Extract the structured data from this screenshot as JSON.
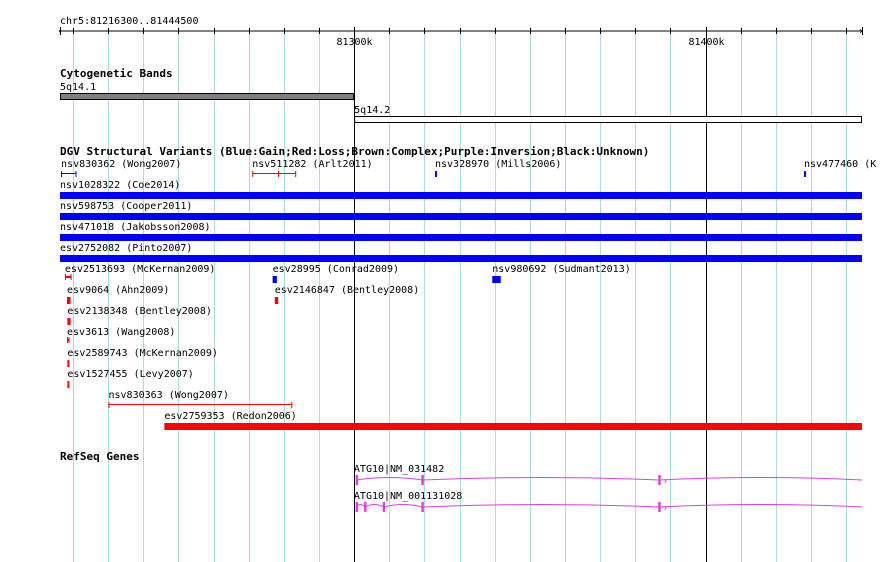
{
  "colors": {
    "gridline": "#add8e6",
    "gain": "#0000ff",
    "loss": "#ff0000",
    "refseq": "#e040e0",
    "cyto_gpos": "#808080",
    "cyto_gneg": "#ffffff"
  },
  "ruler": {
    "label": "chr5:81216300..81444500",
    "region_start": 81216300,
    "region_end": 81444500,
    "major_ticks": [
      {
        "pos": 81300000,
        "label": "81300k"
      },
      {
        "pos": 81400000,
        "label": "81400k"
      }
    ],
    "minor_tick_step": 10000
  },
  "tracks": {
    "cyto": {
      "title": "Cytogenetic Bands",
      "bands": [
        {
          "name": "5q14.1",
          "start": 81216300,
          "end": 81300000,
          "stain": "gpos"
        },
        {
          "name": "5q14.2",
          "start": 81300000,
          "end": 81444500,
          "stain": "gneg"
        }
      ]
    },
    "dgv": {
      "title": "DGV Structural Variants (Blue:Gain;Red:Loss;Brown:Complex;Purple:Inversion;Black:Unknown)",
      "features": [
        {
          "name": "nsv830362 (Wong2007)",
          "type": "gain",
          "start": 81216600,
          "end": 81221000,
          "row": 0,
          "style": "thin"
        },
        {
          "name": "nsv511282 (Arlt2011)",
          "type": "loss",
          "start": 81271000,
          "end": 81283500,
          "row": 0,
          "style": "thin",
          "ticks": [
            81278400
          ]
        },
        {
          "name": "nsv328970 (Mills2006)",
          "type": "gain",
          "start": 81323000,
          "end": 81323600,
          "row": 0,
          "style": "thin"
        },
        {
          "name": "nsv477460 (K",
          "type": "gain",
          "start": 81428000,
          "end": 81428600,
          "row": 0,
          "style": "thin"
        },
        {
          "name": "nsv1028322 (Coe2014)",
          "type": "gain",
          "start": 81216300,
          "end": 81444500,
          "row": 1,
          "style": "thick"
        },
        {
          "name": "nsv598753 (Cooper2011)",
          "type": "gain",
          "start": 81216300,
          "end": 81444500,
          "row": 2,
          "style": "thick"
        },
        {
          "name": "nsv471018 (Jakobsson2008)",
          "type": "gain",
          "start": 81216300,
          "end": 81444500,
          "row": 3,
          "style": "thick"
        },
        {
          "name": "esv2752082 (Pinto2007)",
          "type": "gain",
          "start": 81216300,
          "end": 81444500,
          "row": 4,
          "style": "thick"
        },
        {
          "name": "esv2513693 (McKernan2009)",
          "type": "loss",
          "start": 81217700,
          "end": 81219600,
          "row": 5,
          "style": "tiny"
        },
        {
          "name": "esv28995 (Conrad2009)",
          "type": "gain",
          "start": 81276800,
          "end": 81278000,
          "row": 5,
          "style": "block"
        },
        {
          "name": "nsv980692 (Sudmant2013)",
          "type": "gain",
          "start": 81339300,
          "end": 81341700,
          "row": 5,
          "style": "block"
        },
        {
          "name": "esv9064 (Ahn2009)",
          "type": "loss",
          "start": 81218300,
          "end": 81219300,
          "row": 6,
          "style": "block"
        },
        {
          "name": "esv2146847 (Bentley2008)",
          "type": "loss",
          "start": 81277400,
          "end": 81278400,
          "row": 6,
          "style": "block"
        },
        {
          "name": "esv2138348 (Bentley2008)",
          "type": "loss",
          "start": 81218400,
          "end": 81219300,
          "row": 7,
          "style": "block"
        },
        {
          "name": "esv3613 (Wang2008)",
          "type": "loss",
          "start": 81218300,
          "end": 81219000,
          "row": 8,
          "style": "tiny"
        },
        {
          "name": "esv2589743 (McKernan2009)",
          "type": "loss",
          "start": 81218400,
          "end": 81218900,
          "row": 9,
          "style": "block"
        },
        {
          "name": "esv1527455 (Levy2007)",
          "type": "loss",
          "start": 81218400,
          "end": 81218900,
          "row": 10,
          "style": "block"
        },
        {
          "name": "nsv830363 (Wong2007)",
          "type": "loss",
          "start": 81230100,
          "end": 81282400,
          "row": 11,
          "style": "thin"
        },
        {
          "name": "esv2759353 (Redon2006)",
          "type": "loss",
          "start": 81246000,
          "end": 81444500,
          "row": 12,
          "style": "thick"
        }
      ]
    },
    "refseq": {
      "title": "RefSeq Genes",
      "genes": [
        {
          "name": "ATG10|NM_031482",
          "start": 81300500,
          "end": 81444500,
          "exons": [
            81300700,
            81319400,
            81386800
          ],
          "row": 0
        },
        {
          "name": "ATG10|NM_001131028",
          "start": 81300500,
          "end": 81444500,
          "exons": [
            81300700,
            81303100,
            81308400,
            81319400,
            81386800
          ],
          "row": 1
        }
      ]
    }
  }
}
